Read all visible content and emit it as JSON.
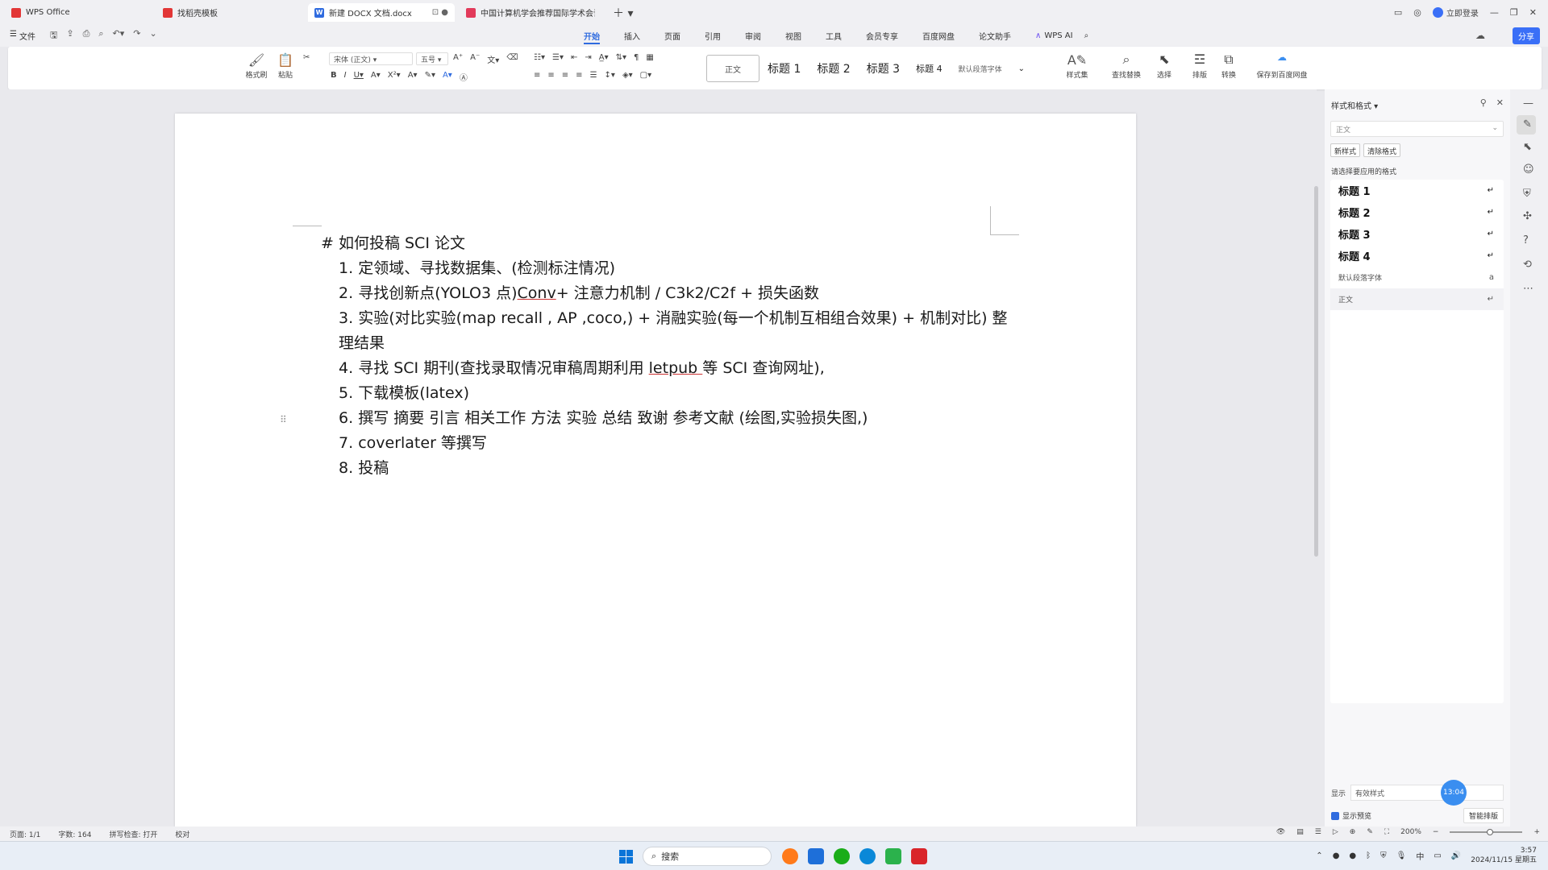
{
  "tabs": [
    {
      "label": "WPS Office",
      "icon": "wps-logo-icon",
      "color": "#e23636",
      "active": false
    },
    {
      "label": "找稻壳模板",
      "icon": "docer-icon",
      "color": "#e23636",
      "active": false
    },
    {
      "label": "新建 DOCX 文档.docx",
      "icon": "writer-doc-icon",
      "color": "#2f6bdf",
      "active": true
    },
    {
      "label": "中国计算机学会推荐国际学术会议和期",
      "icon": "pdf-doc-icon",
      "color": "#e23a5a",
      "active": false
    }
  ],
  "login_label": "立即登录",
  "file_menu": "文件",
  "menu_tabs": [
    "开始",
    "插入",
    "页面",
    "引用",
    "审阅",
    "视图",
    "工具",
    "会员专享",
    "百度网盘",
    "论文助手"
  ],
  "wps_ai": "WPS AI",
  "share_label": "分享",
  "ribbon": {
    "format_painter": "格式刷",
    "paste": "粘贴",
    "font_name": "宋体 (正文)",
    "font_size": "五号",
    "styles": [
      "正文",
      "标题 1",
      "标题 2",
      "标题 3",
      "标题 4",
      "默认段落字体"
    ],
    "style_panel_btn": "样式集",
    "find_replace": "查找替换",
    "select": "选择",
    "layout": "排版",
    "word_to_pdf": "转换",
    "save_cloud": "保存到百度网盘"
  },
  "document": {
    "heading": "#  如何投稿 SCI 论文",
    "items": [
      {
        "num": "1.",
        "text": "定领域、寻找数据集、(检测标注情况)"
      },
      {
        "num": "2.",
        "pre": "寻找创新点(YOLO3 点)",
        "u": "Conv",
        "post": "+    注意力机制  / C3k2/C2f +  损失函数"
      },
      {
        "num": "3.",
        "text": "实验(对比实验(map    recall , AP ,coco,)   +  消融实验(每一个机制互相组合效果)   +  机制对比)   整理结果"
      },
      {
        "num": "4.",
        "pre": "寻找 SCI 期刊(查找录取情况审稿周期利用 ",
        "u": "letpub ",
        "post": "等 SCI 查询网址),"
      },
      {
        "num": "5.",
        "text": "下载模板(latex)"
      },
      {
        "num": "6.",
        "text": "撰写  摘要  引言  相关工作  方法  实验  总结  致谢  参考文献  (绘图,实验损失图,)"
      },
      {
        "num": "7.",
        "text": "coverlater 等撰写"
      },
      {
        "num": "8.",
        "text": "投稿"
      }
    ]
  },
  "side_panel": {
    "title": "样式和格式",
    "current_style": "正文",
    "new_style_btn": "新样式",
    "clear_format_btn": "清除格式",
    "list_label": "请选择要应用的格式",
    "styles": [
      {
        "label": "标题  1",
        "bold": true
      },
      {
        "label": "标题  2",
        "bold": true
      },
      {
        "label": "标题  3",
        "bold": true
      },
      {
        "label": "标题  4",
        "bold": true
      },
      {
        "label": "默认段落字体",
        "bold": false
      },
      {
        "label": "正文",
        "bold": false
      }
    ],
    "show_label": "显示",
    "show_value": "有效样式",
    "preview_label": "显示预览",
    "smart_layout": "智能排版"
  },
  "timer": "13:04",
  "status": {
    "page": "页面: 1/1",
    "words": "字数: 164",
    "spell": "拼写检查: 打开",
    "proof": "校对",
    "zoom": "200%"
  },
  "taskbar": {
    "search": "搜索",
    "time": "3:57",
    "date": "2024/11/15 星期五",
    "ime": "中"
  }
}
